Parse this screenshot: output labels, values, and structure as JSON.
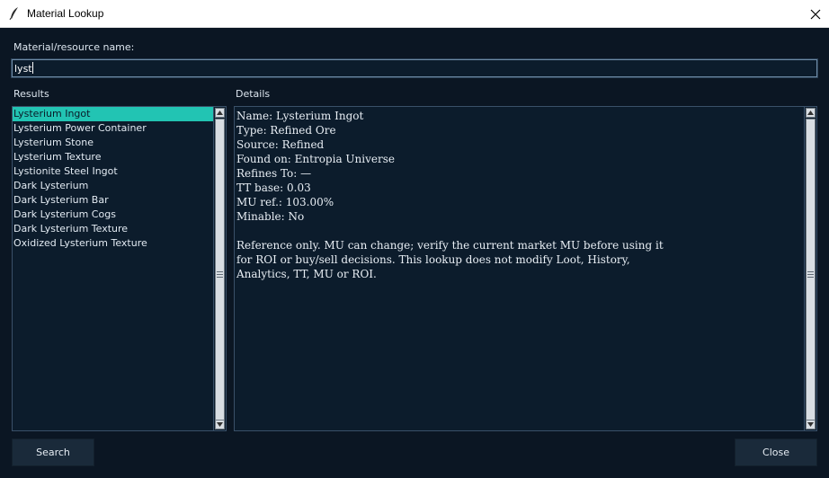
{
  "window": {
    "title": "Material Lookup",
    "close_icon": "close-icon"
  },
  "form": {
    "name_label": "Material/resource name:",
    "search_value": "lyst",
    "results_label": "Results",
    "details_label": "Details"
  },
  "results": {
    "items": [
      "Lysterium Ingot",
      "Lysterium Power Container",
      "Lysterium Stone",
      "Lysterium Texture",
      "Lystionite Steel Ingot",
      "Dark Lysterium",
      "Dark Lysterium Bar",
      "Dark Lysterium Cogs",
      "Dark Lysterium Texture",
      "Oxidized Lysterium Texture"
    ],
    "selected_index": 0
  },
  "details": {
    "lines": [
      "Name: Lysterium Ingot",
      "Type: Refined Ore",
      "Source: Refined",
      "Found on: Entropia Universe",
      "Refines To: —",
      "TT base: 0.03",
      "MU ref.: 103.00%",
      "Minable: No",
      "",
      "Reference only. MU can change; verify the current market MU before using it",
      "for ROI or buy/sell decisions. This lookup does not modify Loot, History,",
      "Analytics, TT, MU or ROI."
    ]
  },
  "buttons": {
    "search_label": "Search",
    "close_label": "Close"
  },
  "colors": {
    "background": "#0b1623",
    "field": "#0c1c2c",
    "selection": "#22c4b3",
    "button": "#1a2a3a"
  }
}
